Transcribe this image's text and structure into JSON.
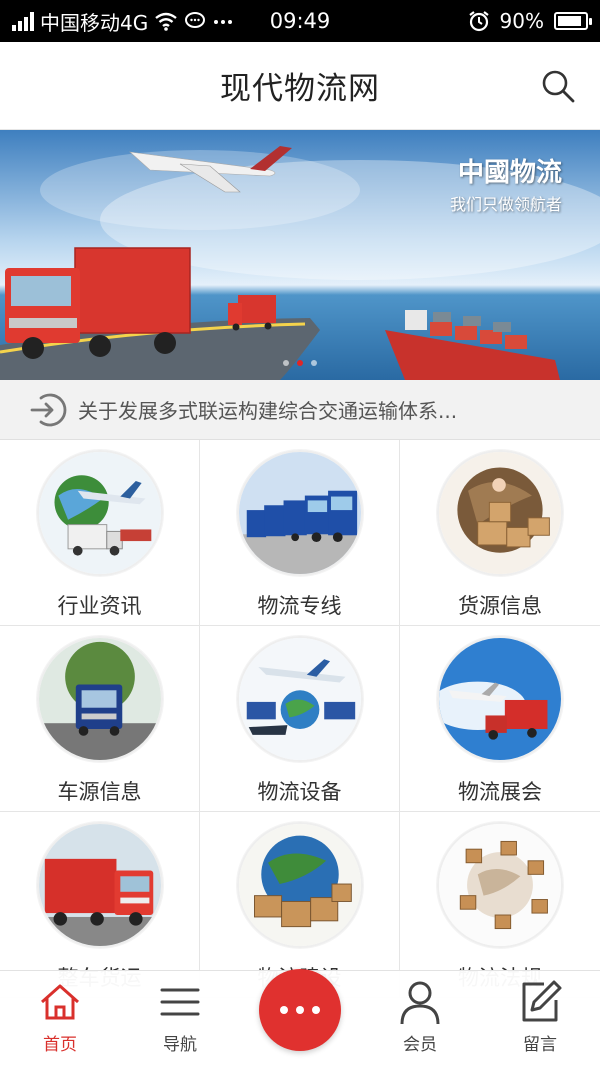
{
  "status_bar": {
    "carrier": "中国移动4G",
    "time": "09:49",
    "battery": "90%",
    "battery_level": 0.9
  },
  "header": {
    "title": "现代物流网"
  },
  "banner": {
    "title": "中國物流",
    "subtitle": "我们只做领航者",
    "slide_count": 3,
    "active_slide": 1
  },
  "notice": {
    "text": "关于发展多式联运构建综合交通运输体系..."
  },
  "grid": {
    "items": [
      {
        "label": "行业资讯",
        "icon": "globe-plane-truck"
      },
      {
        "label": "物流专线",
        "icon": "truck-fleet"
      },
      {
        "label": "货源信息",
        "icon": "globe-boxes"
      },
      {
        "label": "车源信息",
        "icon": "blue-truck-road"
      },
      {
        "label": "物流设备",
        "icon": "plane-globe-trucks"
      },
      {
        "label": "物流展会",
        "icon": "plane-red-trucks"
      },
      {
        "label": "整车货运",
        "icon": "red-truck"
      },
      {
        "label": "物流建设",
        "icon": "earth-boxes"
      },
      {
        "label": "物流法规",
        "icon": "globe-parcels"
      }
    ]
  },
  "bottom_nav": {
    "items": [
      {
        "label": "首页",
        "icon": "home-icon",
        "active": true
      },
      {
        "label": "导航",
        "icon": "menu-icon",
        "active": false
      },
      {
        "label": "",
        "icon": "more-icon",
        "active": false
      },
      {
        "label": "会员",
        "icon": "user-icon",
        "active": false
      },
      {
        "label": "留言",
        "icon": "edit-icon",
        "active": false
      }
    ]
  },
  "colors": {
    "accent": "#e0312f",
    "active_nav": "#d9302c",
    "status_bar": "#000000"
  }
}
